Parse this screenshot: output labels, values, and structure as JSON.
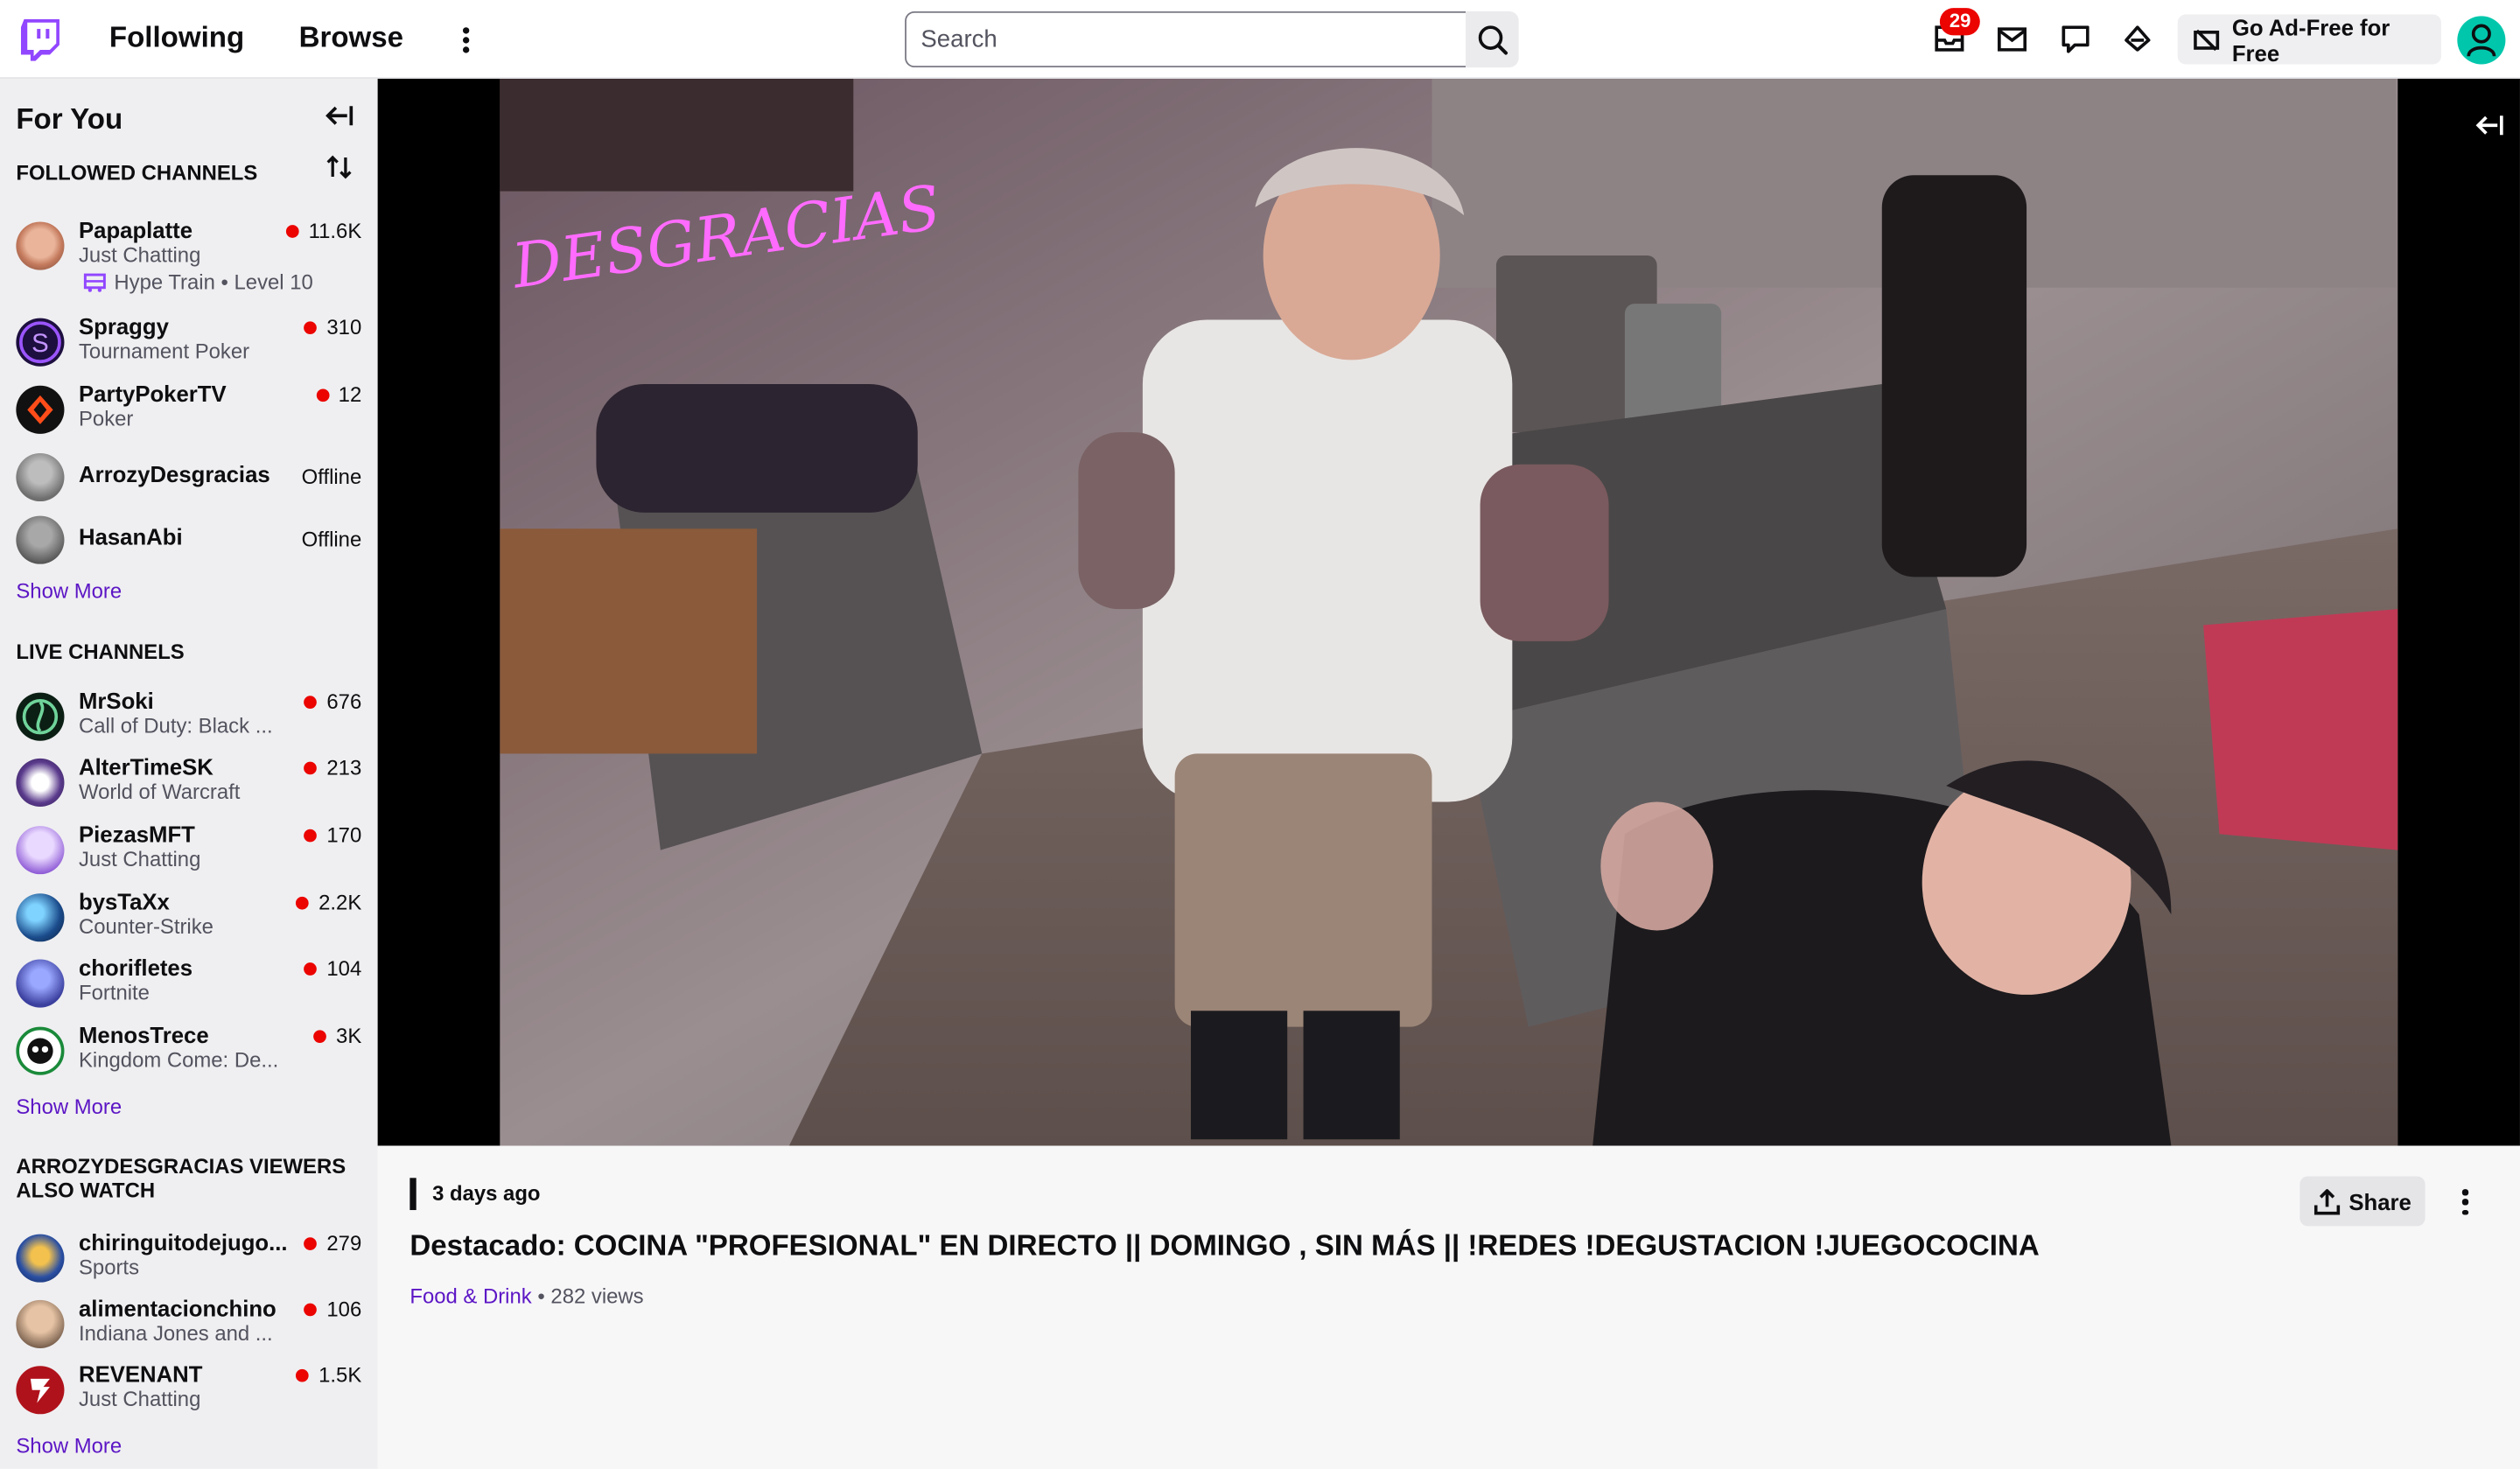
{
  "nav": {
    "following": "Following",
    "browse": "Browse",
    "search_placeholder": "Search",
    "notifications_count": "29",
    "adfree": "Go Ad-Free for Free"
  },
  "sidebar": {
    "title": "For You",
    "followed_header": "FOLLOWED CHANNELS",
    "followed": [
      {
        "name": "Papaplatte",
        "game": "Just Chatting",
        "viewers": "11.6K",
        "live": true,
        "hype": "Hype Train",
        "hype_level": "Level 10"
      },
      {
        "name": "Spraggy",
        "game": "Tournament Poker",
        "viewers": "310",
        "live": true
      },
      {
        "name": "PartyPokerTV",
        "game": "Poker",
        "viewers": "12",
        "live": true
      },
      {
        "name": "ArrozyDesgracias",
        "status": "Offline",
        "live": false
      },
      {
        "name": "HasanAbi",
        "status": "Offline",
        "live": false
      }
    ],
    "show_more": "Show More",
    "live_header": "LIVE CHANNELS",
    "live": [
      {
        "name": "MrSoki",
        "game": "Call of Duty: Black ...",
        "viewers": "676"
      },
      {
        "name": "AlterTimeSK",
        "game": "World of Warcraft",
        "viewers": "213"
      },
      {
        "name": "PiezasMFT",
        "game": "Just Chatting",
        "viewers": "170"
      },
      {
        "name": "bysTaXx",
        "game": "Counter-Strike",
        "viewers": "2.2K"
      },
      {
        "name": "chorifletes",
        "game": "Fortnite",
        "viewers": "104"
      },
      {
        "name": "MenosTrece",
        "game": "Kingdom Come: De...",
        "viewers": "3K"
      }
    ],
    "also_header_1": "ARROZYDESGRACIAS VIEWERS",
    "also_header_2": "ALSO WATCH",
    "also": [
      {
        "name": "chiringuitodejugo...",
        "game": "Sports",
        "viewers": "279"
      },
      {
        "name": "alimentacionchino",
        "game": "Indiana Jones and ...",
        "viewers": "106"
      },
      {
        "name": "REVENANT",
        "game": "Just Chatting",
        "viewers": "1.5K"
      }
    ]
  },
  "video": {
    "neon_sign": "DESGRACIAS"
  },
  "info": {
    "ago": "3 days ago",
    "title": "Destacado: COCINA \"PROFESIONAL\" EN DIRECTO || DOMINGO , SIN MÁS || !REDES !DEGUSTACION !JUEGOCOCINA",
    "category": "Food & Drink",
    "separator": "•",
    "views": "282 views",
    "share": "Share"
  },
  "colors": {
    "brand": "#9146ff",
    "live": "#eb0400",
    "link": "#5c16c5",
    "avatar_top": "#00c7ac"
  }
}
